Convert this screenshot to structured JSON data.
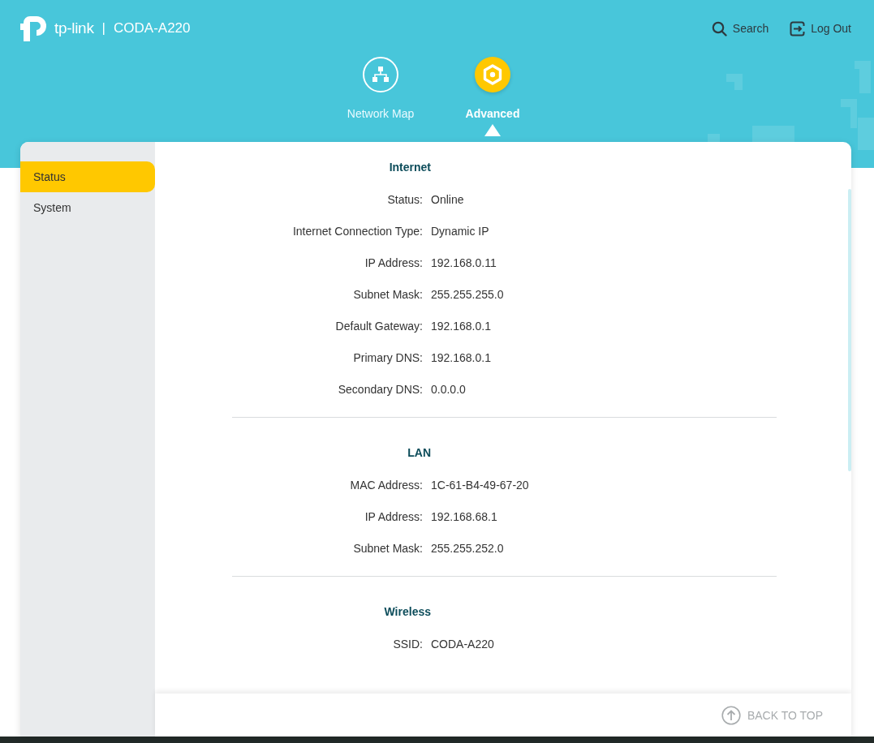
{
  "header": {
    "brand": "tp-link",
    "separator": "|",
    "model": "CODA-A220",
    "actions": [
      {
        "kind": "search",
        "label": "Search"
      },
      {
        "kind": "logout",
        "label": "Log Out"
      }
    ]
  },
  "nav_tabs": [
    {
      "kind": "network",
      "label": "Network Map",
      "selected": false
    },
    {
      "kind": "advanced",
      "label": "Advanced",
      "selected": true
    }
  ],
  "sidebar": {
    "items": [
      {
        "label": "Status",
        "selected": true
      },
      {
        "label": "System",
        "selected": false
      }
    ]
  },
  "sections": [
    {
      "title": "Internet",
      "rows": [
        {
          "label": "Status:",
          "value": "Online"
        },
        {
          "label": "Internet Connection Type:",
          "value": "Dynamic IP"
        },
        {
          "label": "IP Address:",
          "value": "192.168.0.11"
        },
        {
          "label": "Subnet Mask:",
          "value": "255.255.255.0"
        },
        {
          "label": "Default Gateway:",
          "value": "192.168.0.1"
        },
        {
          "label": "Primary DNS:",
          "value": "192.168.0.1"
        },
        {
          "label": "Secondary DNS:",
          "value": "0.0.0.0"
        }
      ]
    },
    {
      "title": "LAN",
      "rows": [
        {
          "label": "MAC Address:",
          "value": "1C-61-B4-49-67-20"
        },
        {
          "label": "IP Address:",
          "value": "192.168.68.1"
        },
        {
          "label": "Subnet Mask:",
          "value": "255.255.252.0"
        }
      ]
    },
    {
      "title": "Wireless",
      "rows": [
        {
          "label": "SSID:",
          "value": "CODA-A220"
        }
      ]
    }
  ],
  "back_to_top": {
    "label": "BACK TO TOP"
  }
}
